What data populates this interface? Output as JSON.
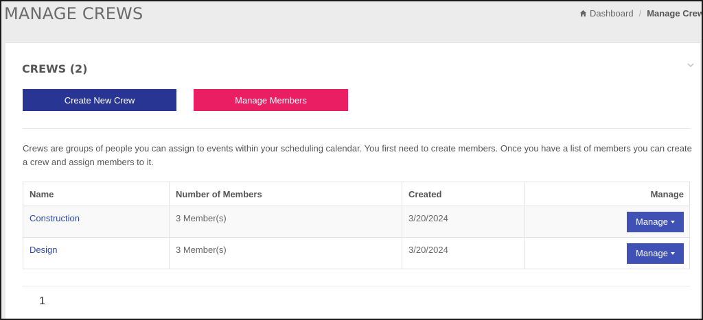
{
  "header": {
    "title": "MANAGE CREWS",
    "breadcrumb": {
      "home_label": "Dashboard",
      "separator": "/",
      "current_label": "Manage Crew"
    }
  },
  "card": {
    "title": "CREWS (2)",
    "buttons": {
      "create_label": "Create New Crew",
      "members_label": "Manage Members"
    },
    "description": "Crews are groups of people you can assign to events within your scheduling calendar. You first need to create members. Once you have a list of members you can create a crew and assign members to it.",
    "table": {
      "headers": {
        "name": "Name",
        "members": "Number of Members",
        "created": "Created",
        "manage": "Manage"
      },
      "rows": [
        {
          "name": "Construction",
          "members": "3 Member(s)",
          "created": "3/20/2024",
          "manage_label": "Manage"
        },
        {
          "name": "Design",
          "members": "3 Member(s)",
          "created": "3/20/2024",
          "manage_label": "Manage"
        }
      ]
    },
    "pagination": {
      "current_page": "1"
    }
  },
  "colors": {
    "create_button": "#283593",
    "members_button": "#e91e63",
    "manage_button": "#3f51b5",
    "link": "#2f48a8"
  },
  "icons": {
    "home": "home-icon",
    "collapse": "chevron-down-icon",
    "dropdown": "caret-down-icon"
  }
}
